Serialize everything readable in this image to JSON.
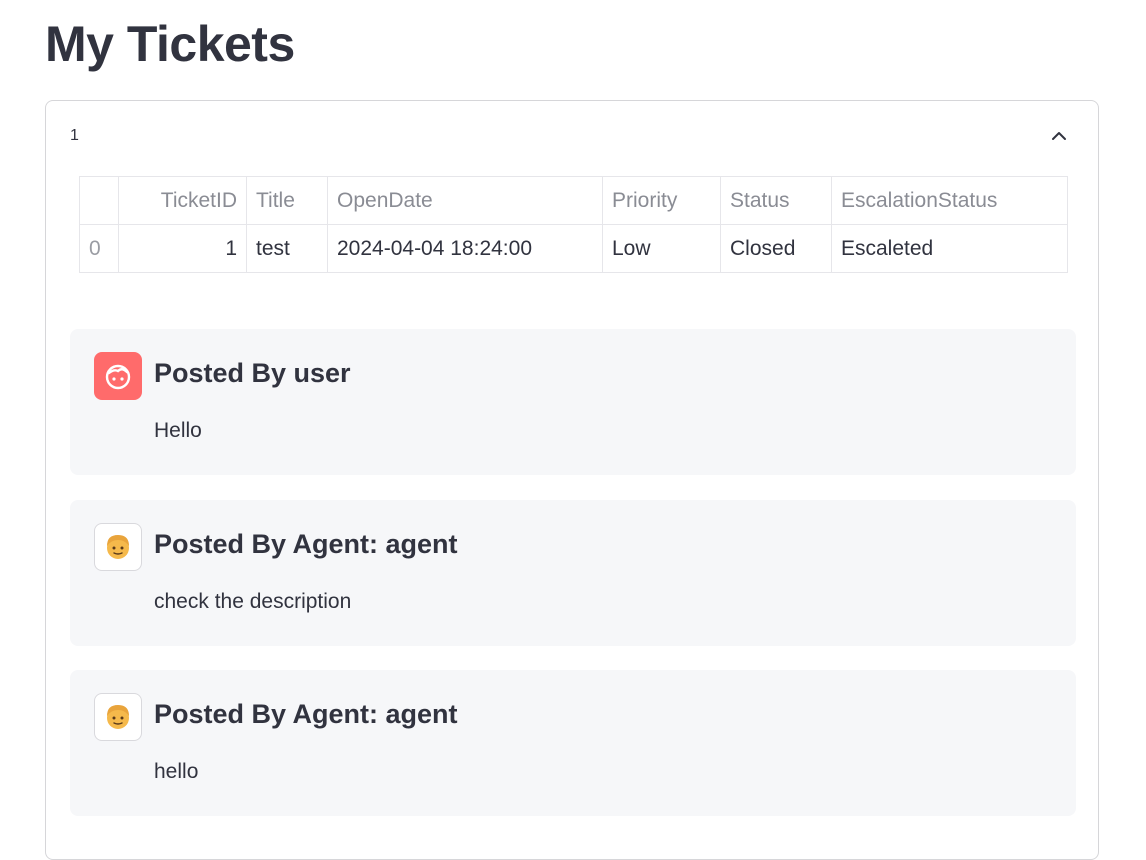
{
  "page": {
    "title": "My Tickets"
  },
  "expander": {
    "label": "1"
  },
  "table": {
    "columns": [
      "",
      "TicketID",
      "Title",
      "OpenDate",
      "Priority",
      "Status",
      "EscalationStatus"
    ],
    "rows": [
      {
        "index": "0",
        "TicketID": "1",
        "Title": "test",
        "OpenDate": "2024-04-04 18:24:00",
        "Priority": "Low",
        "Status": "Closed",
        "EscalationStatus": "Escaleted"
      }
    ]
  },
  "messages": [
    {
      "title": "Posted By user",
      "body": "Hello",
      "avatar": "user-face-icon"
    },
    {
      "title": "Posted By Agent: agent",
      "body": "check the description",
      "avatar": "older-person-emoji-icon"
    },
    {
      "title": "Posted By Agent: agent",
      "body": "hello",
      "avatar": "older-person-emoji-icon"
    }
  ],
  "colors": {
    "user_avatar": "#ff6b6b",
    "message_bg": "#f6f7f9",
    "text": "#31333f"
  }
}
